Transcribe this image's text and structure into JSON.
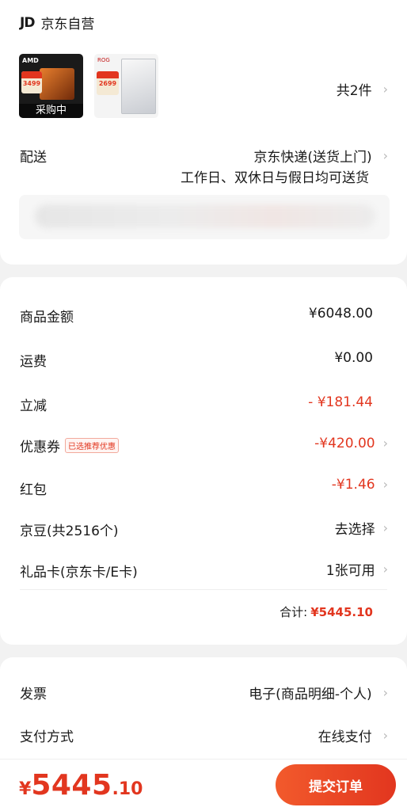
{
  "store": {
    "logo_text": "JD",
    "name": "京东自营"
  },
  "products": {
    "item1": {
      "brand": "AMD",
      "price_tag": "3499",
      "overlay": "采购中"
    },
    "item2": {
      "brand": "ROG",
      "price_tag": "2699"
    },
    "count_label": "共2件"
  },
  "delivery": {
    "label": "配送",
    "method": "京东快递(送货上门)",
    "schedule": "工作日、双休日与假日均可送货"
  },
  "amounts": {
    "goods_label": "商品金额",
    "goods_value": "¥6048.00",
    "freight_label": "运费",
    "freight_value": "¥0.00",
    "discount_label": "立减",
    "discount_value": "- ¥181.44",
    "coupon_label": "优惠券",
    "coupon_badge": "已选推荐优惠",
    "coupon_value": "-¥420.00",
    "redpacket_label": "红包",
    "redpacket_value": "-¥1.46",
    "beans_label": "京豆(共2516个)",
    "beans_value": "去选择",
    "giftcard_label": "礼品卡(京东卡/E卡)",
    "giftcard_value": "1张可用",
    "total_label": "合计:",
    "total_value": "¥5445.10"
  },
  "invoice": {
    "label": "发票",
    "value": "电子(商品明细-个人)"
  },
  "payment": {
    "label": "支付方式",
    "value": "在线支付"
  },
  "footer": {
    "currency": "¥",
    "price_int": "5445",
    "price_dec": ".10",
    "submit_label": "提交订单"
  },
  "colors": {
    "accent": "#e2361f",
    "button_start": "#f25a2c",
    "button_end": "#e2361f"
  }
}
